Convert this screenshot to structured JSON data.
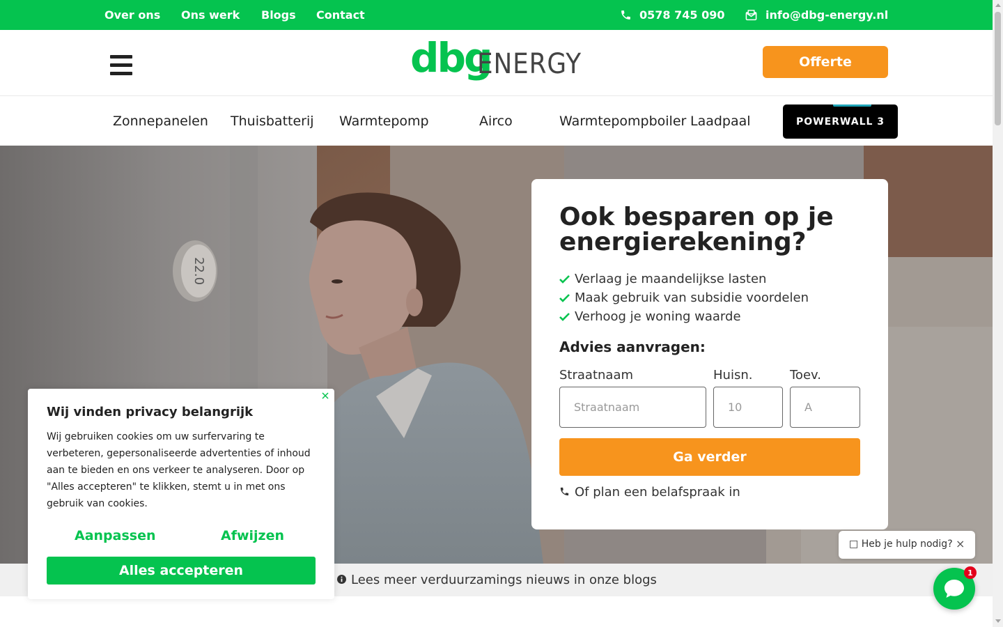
{
  "topbar": {
    "links": [
      "Over ons",
      "Ons werk",
      "Blogs",
      "Contact"
    ],
    "phone": "0578 745 090",
    "email": "info@dbg-energy.nl"
  },
  "header": {
    "logo_brand": "dbg",
    "logo_word": "ENERGY",
    "offerte_label": "Offerte"
  },
  "products": {
    "items": [
      "Zonnepanelen",
      "Thuisbatterij",
      "Warmtepomp",
      "Airco",
      "Warmtepompboiler",
      "Laadpaal"
    ],
    "highlight": "POWERWALL 3"
  },
  "form": {
    "title": "Ook besparen op je energierekening?",
    "benefits": [
      "Verlaag je maandelijkse lasten",
      "Maak gebruik van subsidie voordelen",
      "Verhoog je woning waarde"
    ],
    "section_title": "Advies aanvragen:",
    "street_label": "Straatnaam",
    "street_placeholder": "Straatnaam",
    "number_label": "Huisn.",
    "number_placeholder": "10",
    "addition_label": "Toev.",
    "addition_placeholder": "A",
    "submit_label": "Ga verder",
    "call_text": "Of plan een belafspraak in"
  },
  "blogs_strip": {
    "text": "Lees meer verduurzamings nieuws in onze blogs"
  },
  "cookie": {
    "title": "Wij vinden privacy belangrijk",
    "body": "Wij gebruiken cookies om uw surfervaring te verbeteren, gepersonaliseerde advertenties of inhoud aan te bieden en ons verkeer te analyseren. Door op \"Alles accepteren\" te klikken, stemt u in met ons gebruik van cookies.",
    "customize_label": "Aanpassen",
    "reject_label": "Afwijzen",
    "accept_label": "Alles accepteren"
  },
  "chat": {
    "help_text": "Heb je hulp nodig?",
    "close_label": "×",
    "badge_count": "1"
  },
  "thermostat_display": "22.0",
  "colors": {
    "brand_green": "#05c34f",
    "accent_orange": "#f7941d",
    "powerwall_black": "#000000"
  }
}
